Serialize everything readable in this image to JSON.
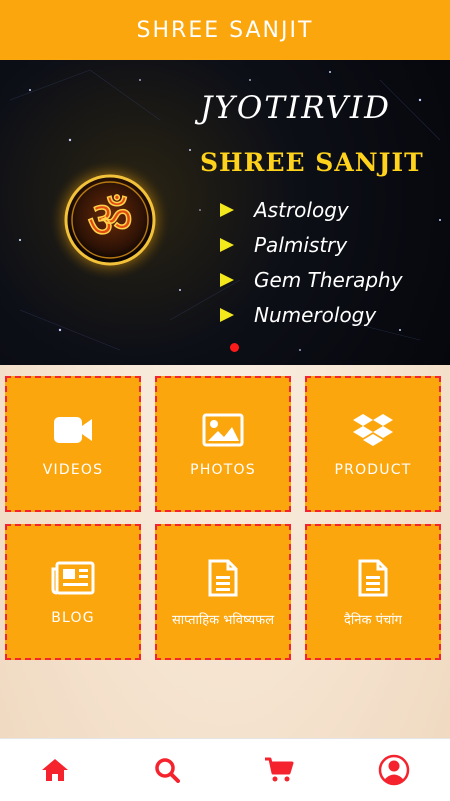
{
  "appbar": {
    "title": "SHREE SANJIT"
  },
  "banner": {
    "heading": "JYOTIRVID",
    "name": "SHREE SANJIT",
    "services": [
      "Astrology",
      "Palmistry",
      "Gem Theraphy",
      "Numerology"
    ],
    "pager": {
      "active_index": 0
    }
  },
  "tiles": [
    {
      "label": "VIDEOS",
      "icon": "video-camera-icon"
    },
    {
      "label": "PHOTOS",
      "icon": "image-icon"
    },
    {
      "label": "PRODUCT",
      "icon": "dropbox-icon"
    },
    {
      "label": "BLOG",
      "icon": "newspaper-icon"
    },
    {
      "label": "साप्ताहिक भविष्यफल",
      "icon": "document-icon"
    },
    {
      "label": "दैनिक पंचांग",
      "icon": "document-icon"
    }
  ],
  "bottom_nav": [
    {
      "name": "home",
      "icon": "home-icon"
    },
    {
      "name": "search",
      "icon": "search-icon"
    },
    {
      "name": "cart",
      "icon": "cart-icon"
    },
    {
      "name": "account",
      "icon": "user-circle-icon"
    }
  ],
  "colors": {
    "primary": "#fca60e",
    "accent": "#f5232d",
    "banner_gold": "#ffd21c"
  }
}
